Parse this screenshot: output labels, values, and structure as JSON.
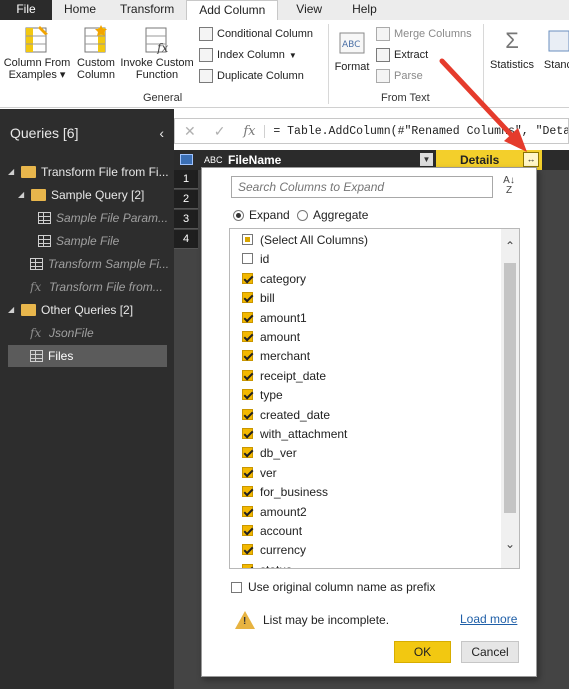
{
  "tabs": [
    {
      "label": "File"
    },
    {
      "label": "Home"
    },
    {
      "label": "Transform"
    },
    {
      "label": "Add Column"
    },
    {
      "label": "View"
    },
    {
      "label": "Help"
    }
  ],
  "ribbon": {
    "column_from_examples": "Column From",
    "column_from_examples_2": "Examples",
    "custom_column": "Custom",
    "custom_column_2": "Column",
    "invoke_custom_function": "Invoke Custom",
    "invoke_custom_function_2": "Function",
    "conditional_column": "Conditional Column",
    "index_column": "Index Column",
    "duplicate_column": "Duplicate Column",
    "group_general": "General",
    "format": "Format",
    "merge_columns": "Merge Columns",
    "extract": "Extract",
    "parse": "Parse",
    "group_from_text": "From Text",
    "statistics": "Statistics",
    "standard": "Stanc"
  },
  "queries": {
    "title": "Queries [6]",
    "items": [
      {
        "label": "Transform File from Fi..."
      },
      {
        "label": "Sample Query [2]"
      },
      {
        "label": "Sample File Param..."
      },
      {
        "label": "Sample File"
      },
      {
        "label": "Transform Sample Fi..."
      },
      {
        "label": "Transform File from..."
      },
      {
        "label": "Other Queries [2]"
      },
      {
        "label": "JsonFile"
      },
      {
        "label": "Files"
      }
    ]
  },
  "formula_bar": {
    "cancel_glyph": "✕",
    "commit_glyph": "✓",
    "fx_glyph": "fx",
    "formula": "= Table.AddColumn(#\"Renamed Columns\", \"Deta"
  },
  "grid": {
    "rows": [
      "1",
      "2",
      "3",
      "4"
    ],
    "column_filename": "FileName",
    "column_details": "Details",
    "abc_label": "ABC"
  },
  "dialog": {
    "search_placeholder": "Search Columns to Expand",
    "expand_label": "Expand",
    "aggregate_label": "Aggregate",
    "columns": [
      {
        "label": "(Select All Columns)",
        "state": "partial"
      },
      {
        "label": "id",
        "state": "off"
      },
      {
        "label": "category",
        "state": "on"
      },
      {
        "label": "bill",
        "state": "on"
      },
      {
        "label": "amount1",
        "state": "on"
      },
      {
        "label": "amount",
        "state": "on"
      },
      {
        "label": "merchant",
        "state": "on"
      },
      {
        "label": "receipt_date",
        "state": "on"
      },
      {
        "label": "type",
        "state": "on"
      },
      {
        "label": "created_date",
        "state": "on"
      },
      {
        "label": "with_attachment",
        "state": "on"
      },
      {
        "label": "db_ver",
        "state": "on"
      },
      {
        "label": "ver",
        "state": "on"
      },
      {
        "label": "for_business",
        "state": "on"
      },
      {
        "label": "amount2",
        "state": "on"
      },
      {
        "label": "account",
        "state": "on"
      },
      {
        "label": "currency",
        "state": "on"
      },
      {
        "label": "status",
        "state": "on"
      }
    ],
    "prefix_label": "Use original column name as prefix",
    "warning_text": "List may be incomplete.",
    "load_more": "Load more",
    "ok": "OK",
    "cancel": "Cancel"
  },
  "colors": {
    "accent_yellow": "#f2c811",
    "checkbox_fill": "#f3b800",
    "arrow_red": "#e53b2c",
    "pane_dark": "#2d2d2d"
  }
}
